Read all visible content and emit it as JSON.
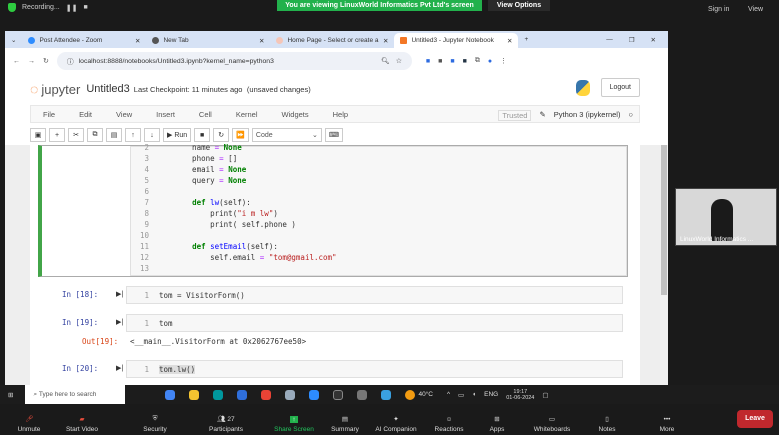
{
  "zoom_top": {
    "recording": "Recording...",
    "banner": "You are viewing LinuxWorld Informatics Pvt Ltd's screen",
    "view_options": "View Options",
    "sign_in": "Sign in",
    "view": "View"
  },
  "browser": {
    "tabs": [
      {
        "label": "Post Attendee - Zoom"
      },
      {
        "label": "New Tab"
      },
      {
        "label": "Home Page - Select or create a"
      },
      {
        "label": "Untitled3 - Jupyter Notebook",
        "active": true
      }
    ],
    "url": "localhost:8888/notebooks/Untitled3.ipynb?kernel_name=python3"
  },
  "jupyter": {
    "logo": "jupyter",
    "notebook_name": "Untitled3",
    "checkpoint": "Last Checkpoint: 11 minutes ago",
    "status": "(unsaved changes)",
    "logout": "Logout",
    "menu": [
      "File",
      "Edit",
      "View",
      "Insert",
      "Cell",
      "Kernel",
      "Widgets",
      "Help"
    ],
    "trusted": "Trusted",
    "kernel": "Python 3 (ipykernel)",
    "toolbar": {
      "run": "Run",
      "cell_type": "Code"
    }
  },
  "cells": {
    "first": {
      "lines": [
        {
          "n": "2",
          "code": "    name = None"
        },
        {
          "n": "3",
          "code": "    phone = []"
        },
        {
          "n": "4",
          "code": "    email = None"
        },
        {
          "n": "5",
          "code": "    query = None"
        },
        {
          "n": "6",
          "code": ""
        },
        {
          "n": "7",
          "code": "    def lw(self):"
        },
        {
          "n": "8",
          "code": "        print(\"i m lw\")"
        },
        {
          "n": "9",
          "code": "        print( self.phone )"
        },
        {
          "n": "10",
          "code": ""
        },
        {
          "n": "11",
          "code": "    def setEmail(self):"
        },
        {
          "n": "12",
          "code": "        self.email = \"tom@gmail.com\""
        },
        {
          "n": "13",
          "code": ""
        }
      ]
    },
    "c18": {
      "prompt": "In [18]:",
      "n": "1",
      "code": "tom = VisitorForm()"
    },
    "c19": {
      "prompt": "In [19]:",
      "n": "1",
      "code": "tom",
      "out_prompt": "Out[19]:",
      "output": "<__main__.VisitorForm at 0x2062767ee50>"
    },
    "c20": {
      "prompt": "In [20]:",
      "n": "1",
      "code": "tom.lw()"
    }
  },
  "taskbar": {
    "search_placeholder": "Type here to search",
    "weather": "40°C",
    "lang": "ENG",
    "time": "19:17",
    "date": "01-06-2024"
  },
  "zoom_bottom": {
    "buttons": [
      "Unmute",
      "Start Video",
      "Security",
      "Participants",
      "Share Screen",
      "Summary",
      "AI Companion",
      "Reactions",
      "Apps",
      "Whiteboards",
      "Notes",
      "More"
    ],
    "participants_count": "27",
    "leave": "Leave"
  },
  "video": {
    "name": "LinuxWorld Informatics ..."
  },
  "colors": {
    "banner": "#22b14c",
    "leave": "#c0282d",
    "cell_selected": "#42a548"
  }
}
